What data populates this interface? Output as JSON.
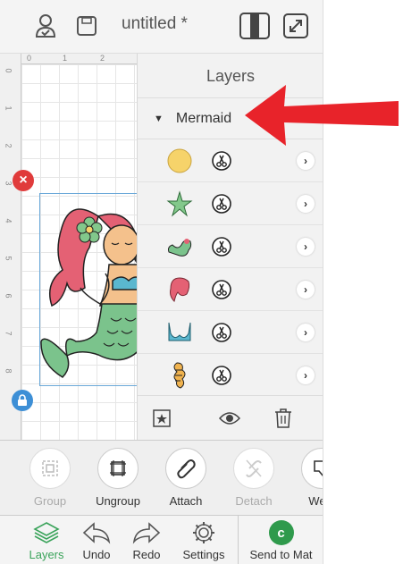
{
  "header": {
    "title": "untitled *"
  },
  "ruler": {
    "top_ticks": [
      "0",
      "1",
      "2"
    ],
    "left_ticks": [
      "0",
      "1",
      "2",
      "3",
      "4",
      "5",
      "6",
      "7",
      "8"
    ]
  },
  "layers_panel": {
    "title": "Layers",
    "group_name": "Mermaid",
    "layers": [
      {
        "thumb": "yellow-circle",
        "color": "#f6d36a"
      },
      {
        "thumb": "green-starfish",
        "color": "#82c88b"
      },
      {
        "thumb": "green-seahorse",
        "color": "#7bc38c"
      },
      {
        "thumb": "pink-hair",
        "color": "#e46174"
      },
      {
        "thumb": "teal-top",
        "color": "#5ab7cf"
      },
      {
        "thumb": "mermaid-details",
        "color": "#f0b34f"
      }
    ]
  },
  "actions": {
    "group": "Group",
    "ungroup": "Ungroup",
    "attach": "Attach",
    "detach": "Detach",
    "weld": "Weld"
  },
  "nav": {
    "layers": "Layers",
    "undo": "Undo",
    "redo": "Redo",
    "settings": "Settings",
    "send_to_mat": "Send to Mat"
  },
  "colors": {
    "accent_green": "#3aa35a",
    "delete_red": "#e03b3b",
    "lock_blue": "#3d8fd6",
    "arrow_red": "#e8232a"
  }
}
